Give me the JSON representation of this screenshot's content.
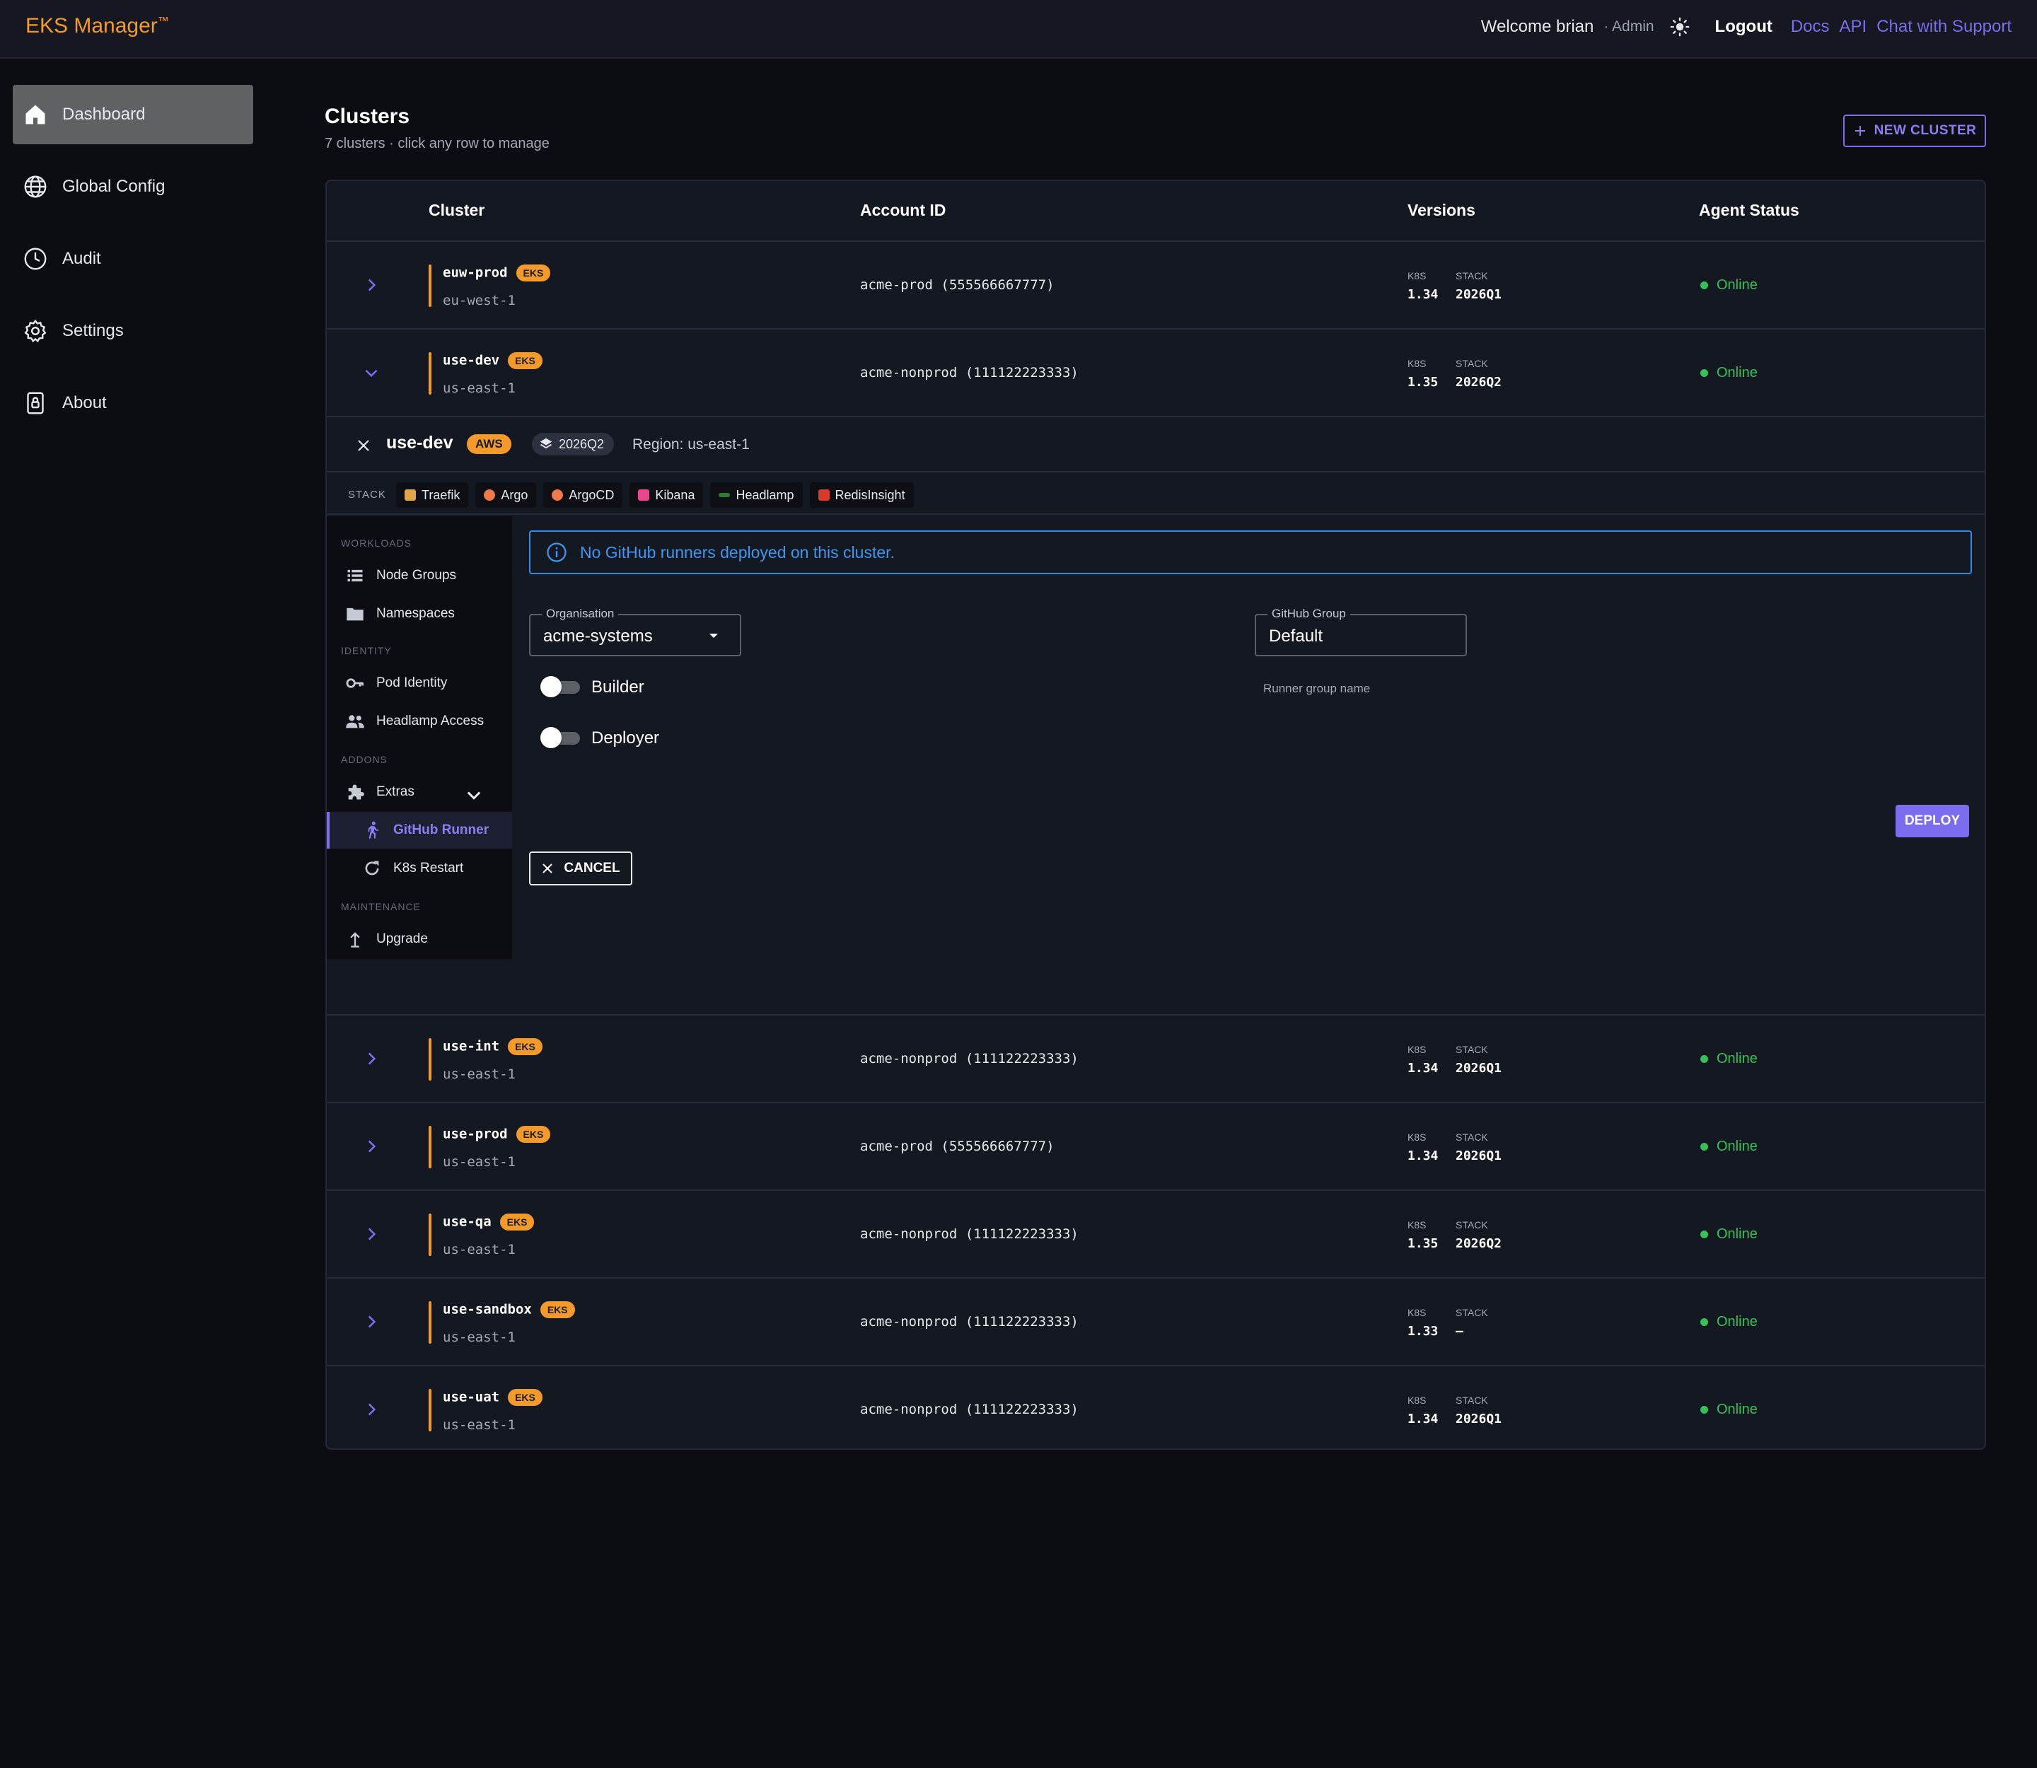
{
  "header": {
    "brand": "EKS Manager",
    "brand_mark": "™",
    "welcome": "Welcome brian",
    "role": "· Admin",
    "logout": "Logout",
    "links": [
      "Docs",
      "API",
      "Chat with Support"
    ]
  },
  "sidebar": {
    "items": [
      {
        "label": "Dashboard",
        "icon": "home-icon",
        "active": true
      },
      {
        "label": "Global Config",
        "icon": "globe-icon"
      },
      {
        "label": "Audit",
        "icon": "clock-icon"
      },
      {
        "label": "Settings",
        "icon": "gear-icon"
      },
      {
        "label": "About",
        "icon": "lock-icon"
      }
    ]
  },
  "main": {
    "title": "Clusters",
    "subtitle": "7 clusters · click any row to manage",
    "new_cluster": "NEW CLUSTER"
  },
  "table": {
    "headers": [
      "Cluster",
      "Account ID",
      "Versions",
      "Agent Status"
    ],
    "k8s_label": "K8S",
    "stack_label": "STACK",
    "rows": [
      {
        "name": "euw-prod",
        "badge": "EKS",
        "region": "eu-west-1",
        "account": "acme-prod (555566667777)",
        "k8s": "1.34",
        "stack": "2026Q1",
        "status": "Online"
      },
      {
        "name": "use-dev",
        "badge": "EKS",
        "region": "us-east-1",
        "account": "acme-nonprod (111122223333)",
        "k8s": "1.35",
        "stack": "2026Q2",
        "status": "Online"
      },
      {
        "name": "use-int",
        "badge": "EKS",
        "region": "us-east-1",
        "account": "acme-nonprod (111122223333)",
        "k8s": "1.34",
        "stack": "2026Q1",
        "status": "Online"
      },
      {
        "name": "use-prod",
        "badge": "EKS",
        "region": "us-east-1",
        "account": "acme-prod (555566667777)",
        "k8s": "1.34",
        "stack": "2026Q1",
        "status": "Online"
      },
      {
        "name": "use-qa",
        "badge": "EKS",
        "region": "us-east-1",
        "account": "acme-nonprod (111122223333)",
        "k8s": "1.35",
        "stack": "2026Q2",
        "status": "Online"
      },
      {
        "name": "use-sandbox",
        "badge": "EKS",
        "region": "us-east-1",
        "account": "acme-nonprod (111122223333)",
        "k8s": "1.33",
        "stack": "—",
        "status": "Online"
      },
      {
        "name": "use-uat",
        "badge": "EKS",
        "region": "us-east-1",
        "account": "acme-nonprod (111122223333)",
        "k8s": "1.34",
        "stack": "2026Q1",
        "status": "Online"
      }
    ]
  },
  "panel": {
    "name": "use-dev",
    "provider": "AWS",
    "stack_version": "2026Q2",
    "region": "Region: us-east-1",
    "stack_label": "STACK",
    "chips": [
      {
        "label": "Traefik",
        "color": "#e0a64a"
      },
      {
        "label": "Argo",
        "color": "#ef7b4d"
      },
      {
        "label": "ArgoCD",
        "color": "#ef7b4d"
      },
      {
        "label": "Kibana",
        "color": "#e8478b"
      },
      {
        "label": "Headlamp",
        "color": "#2e7d32"
      },
      {
        "label": "RedisInsight",
        "color": "#d63a2f"
      }
    ],
    "subnav": {
      "sections": [
        "WORKLOADS",
        "IDENTITY",
        "ADDONS",
        "MAINTENANCE"
      ],
      "node_groups": "Node Groups",
      "namespaces": "Namespaces",
      "pod_identity": "Pod Identity",
      "headlamp_access": "Headlamp Access",
      "extras": "Extras",
      "github_runner": "GitHub Runner",
      "k8s_restart": "K8s Restart",
      "upgrade": "Upgrade"
    },
    "info": "No GitHub runners deployed on this cluster.",
    "organisation_label": "Organisation",
    "organisation_value": "acme-systems",
    "group_label": "GitHub Group",
    "group_value": "Default",
    "group_help": "Runner group name",
    "builder": "Builder",
    "deployer": "Deployer",
    "deploy": "DEPLOY",
    "cancel": "CANCEL"
  },
  "colors": {
    "accent": "#7b6cf0",
    "brand": "#f39a2b",
    "online": "#37c15a",
    "info": "#2f8bf0"
  }
}
